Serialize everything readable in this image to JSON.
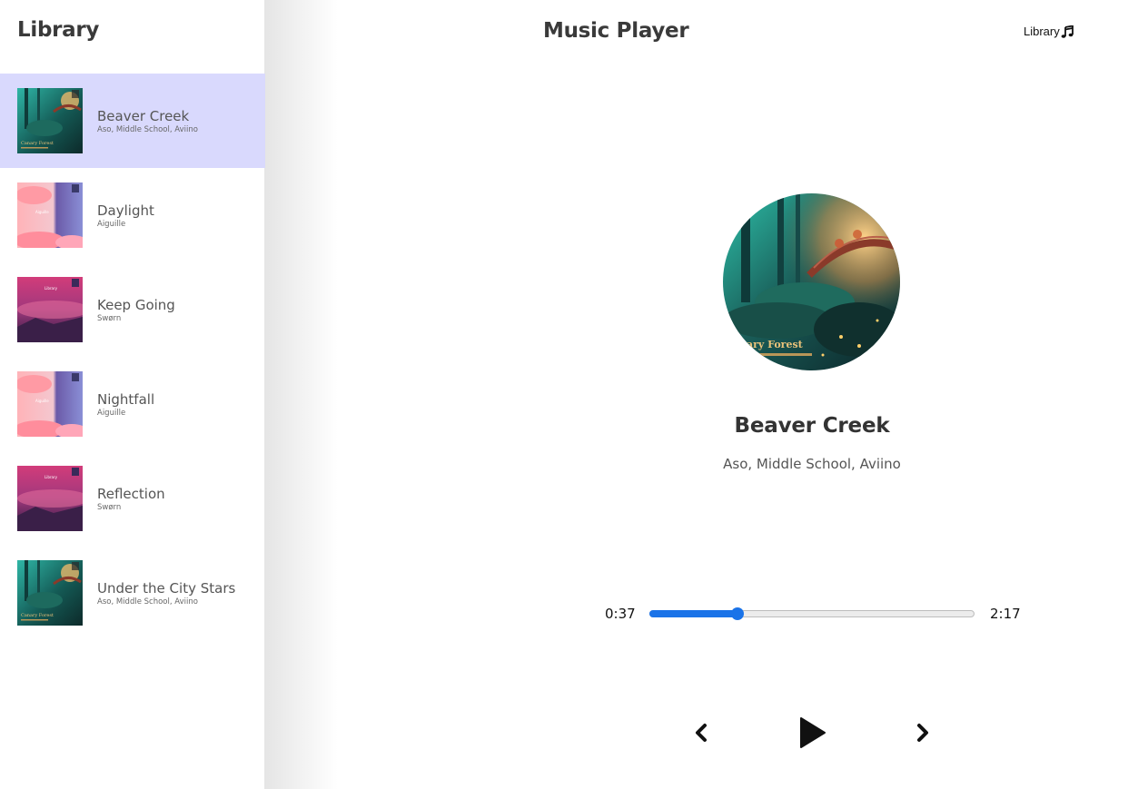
{
  "sidebar": {
    "title": "Library",
    "items": [
      {
        "name": "Beaver Creek",
        "artist": "Aso, Middle School, Aviino",
        "cover": "forest",
        "selected": true
      },
      {
        "name": "Daylight",
        "artist": "Aiguille",
        "cover": "pink"
      },
      {
        "name": "Keep Going",
        "artist": "Swørn",
        "cover": "magenta"
      },
      {
        "name": "Nightfall",
        "artist": "Aiguille",
        "cover": "pink"
      },
      {
        "name": "Reflection",
        "artist": "Swørn",
        "cover": "magenta"
      },
      {
        "name": "Under the City Stars",
        "artist": "Aso, Middle School, Aviino",
        "cover": "forest"
      }
    ]
  },
  "header": {
    "title": "Music Player",
    "library_button_label": "Library",
    "library_button_icon": "music-note-icon"
  },
  "now_playing": {
    "title": "Beaver Creek",
    "artist": "Aso, Middle School, Aviino",
    "cover_text": "nary Forest"
  },
  "player": {
    "current_time": "0:37",
    "total_time": "2:17",
    "progress": 0.27,
    "accent_color": "#1a73e8"
  },
  "controls": {
    "prev_icon": "chevron-left-icon",
    "play_icon": "play-icon",
    "next_icon": "chevron-right-icon"
  },
  "colors": {
    "selected_row": "#d9d9fd"
  }
}
